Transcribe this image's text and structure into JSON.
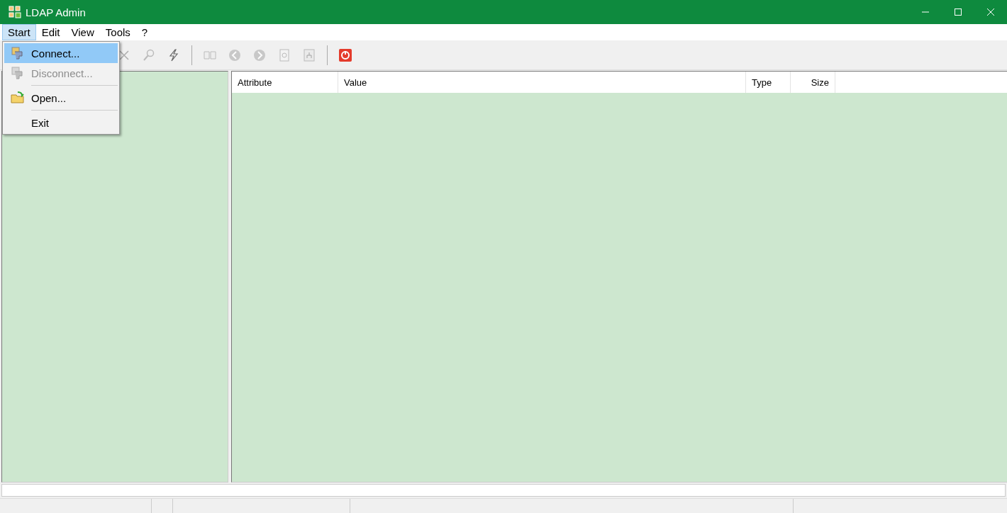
{
  "window": {
    "title": "LDAP Admin"
  },
  "menu": [
    {
      "label": "Start",
      "selected": true
    },
    {
      "label": "Edit",
      "selected": false
    },
    {
      "label": "View",
      "selected": false
    },
    {
      "label": "Tools",
      "selected": false
    },
    {
      "label": "?",
      "selected": false
    }
  ],
  "dropdown": [
    {
      "kind": "item",
      "label": "Connect...",
      "selected": true,
      "disabled": false
    },
    {
      "kind": "item",
      "label": "Disconnect...",
      "selected": false,
      "disabled": true
    },
    {
      "kind": "separator"
    },
    {
      "kind": "item",
      "label": "Open...",
      "selected": false,
      "disabled": false
    },
    {
      "kind": "separator"
    },
    {
      "kind": "item",
      "label": "Exit",
      "selected": false,
      "disabled": false
    }
  ],
  "toolbar": [
    {
      "kind": "button",
      "disabled": true
    },
    {
      "kind": "button",
      "disabled": true
    },
    {
      "kind": "button",
      "disabled": false
    },
    {
      "kind": "separator"
    },
    {
      "kind": "button",
      "disabled": true
    },
    {
      "kind": "button",
      "disabled": true
    },
    {
      "kind": "button",
      "disabled": true
    },
    {
      "kind": "button",
      "disabled": true
    },
    {
      "kind": "button",
      "disabled": true
    },
    {
      "kind": "separator"
    },
    {
      "kind": "button",
      "disabled": false
    }
  ],
  "table": {
    "columns": [
      {
        "label": "Attribute"
      },
      {
        "label": "Value"
      },
      {
        "label": "Type"
      },
      {
        "label": "Size"
      }
    ]
  }
}
